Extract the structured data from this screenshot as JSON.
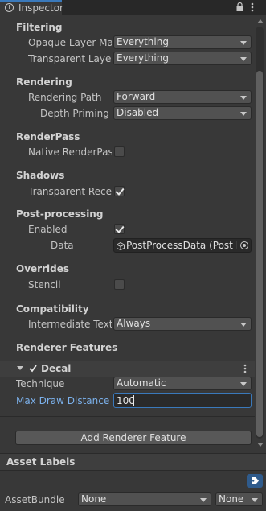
{
  "tab": {
    "title": "Inspector"
  },
  "sections": {
    "filtering": "Filtering",
    "rendering": "Rendering",
    "renderpass": "RenderPass",
    "shadows": "Shadows",
    "postprocessing": "Post-processing",
    "overrides": "Overrides",
    "compatibility": "Compatibility",
    "renderer_features": "Renderer Features"
  },
  "fields": {
    "opaque_layer_mask": {
      "label": "Opaque Layer Mas",
      "value": "Everything"
    },
    "transparent_layer": {
      "label": "Transparent Layer",
      "value": "Everything"
    },
    "rendering_path": {
      "label": "Rendering Path",
      "value": "Forward"
    },
    "depth_priming": {
      "label": "Depth Priming M",
      "value": "Disabled"
    },
    "native_renderpass": {
      "label": "Native RenderPass",
      "checked": false
    },
    "transparent_receive": {
      "label": "Transparent Recei",
      "checked": true
    },
    "pp_enabled": {
      "label": "Enabled",
      "checked": true
    },
    "pp_data": {
      "label": "Data",
      "value": "PostProcessData (Post P"
    },
    "stencil": {
      "label": "Stencil",
      "checked": false
    },
    "intermediate_texture": {
      "label": "Intermediate Textu",
      "value": "Always"
    }
  },
  "decal": {
    "title": "Decal",
    "technique_label": "Technique",
    "technique_value": "Automatic",
    "max_draw_label": "Max Draw Distance",
    "max_draw_value": "100"
  },
  "add_feature_button": "Add Renderer Feature",
  "asset_labels": {
    "title": "Asset Labels",
    "assetbundle_label": "AssetBundle",
    "bundle_value": "None",
    "variant_value": "None"
  }
}
